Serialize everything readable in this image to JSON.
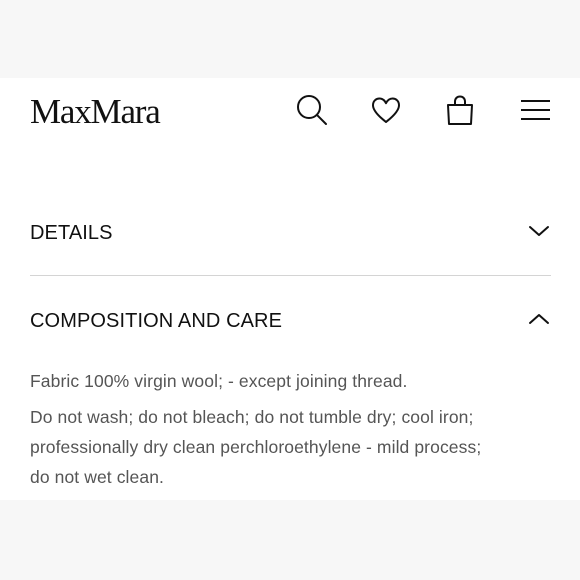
{
  "header": {
    "brand": "MaxMara",
    "icons": {
      "search": "search-icon",
      "wishlist": "heart-icon",
      "bag": "shopping-bag-icon",
      "menu": "hamburger-menu-icon"
    }
  },
  "accordion": {
    "details": {
      "title": "DETAILS",
      "state": "collapsed",
      "icon": "chevron-down-icon"
    },
    "composition": {
      "title": "COMPOSITION AND CARE",
      "state": "expanded",
      "icon": "chevron-up-icon",
      "fabric": "Fabric 100% virgin wool; - except joining thread.",
      "care_line_1": "Do not wash; do not bleach; do not tumble dry; cool iron;",
      "care_line_2": "professionally dry clean perchloroethylene - mild process;",
      "care_line_3": "do not wet clean."
    }
  },
  "colors": {
    "page_background": "#f7f7f7",
    "panel_background": "#ffffff",
    "text": "#111111",
    "secondary_text": "#555555",
    "divider": "#d4d4d4"
  }
}
